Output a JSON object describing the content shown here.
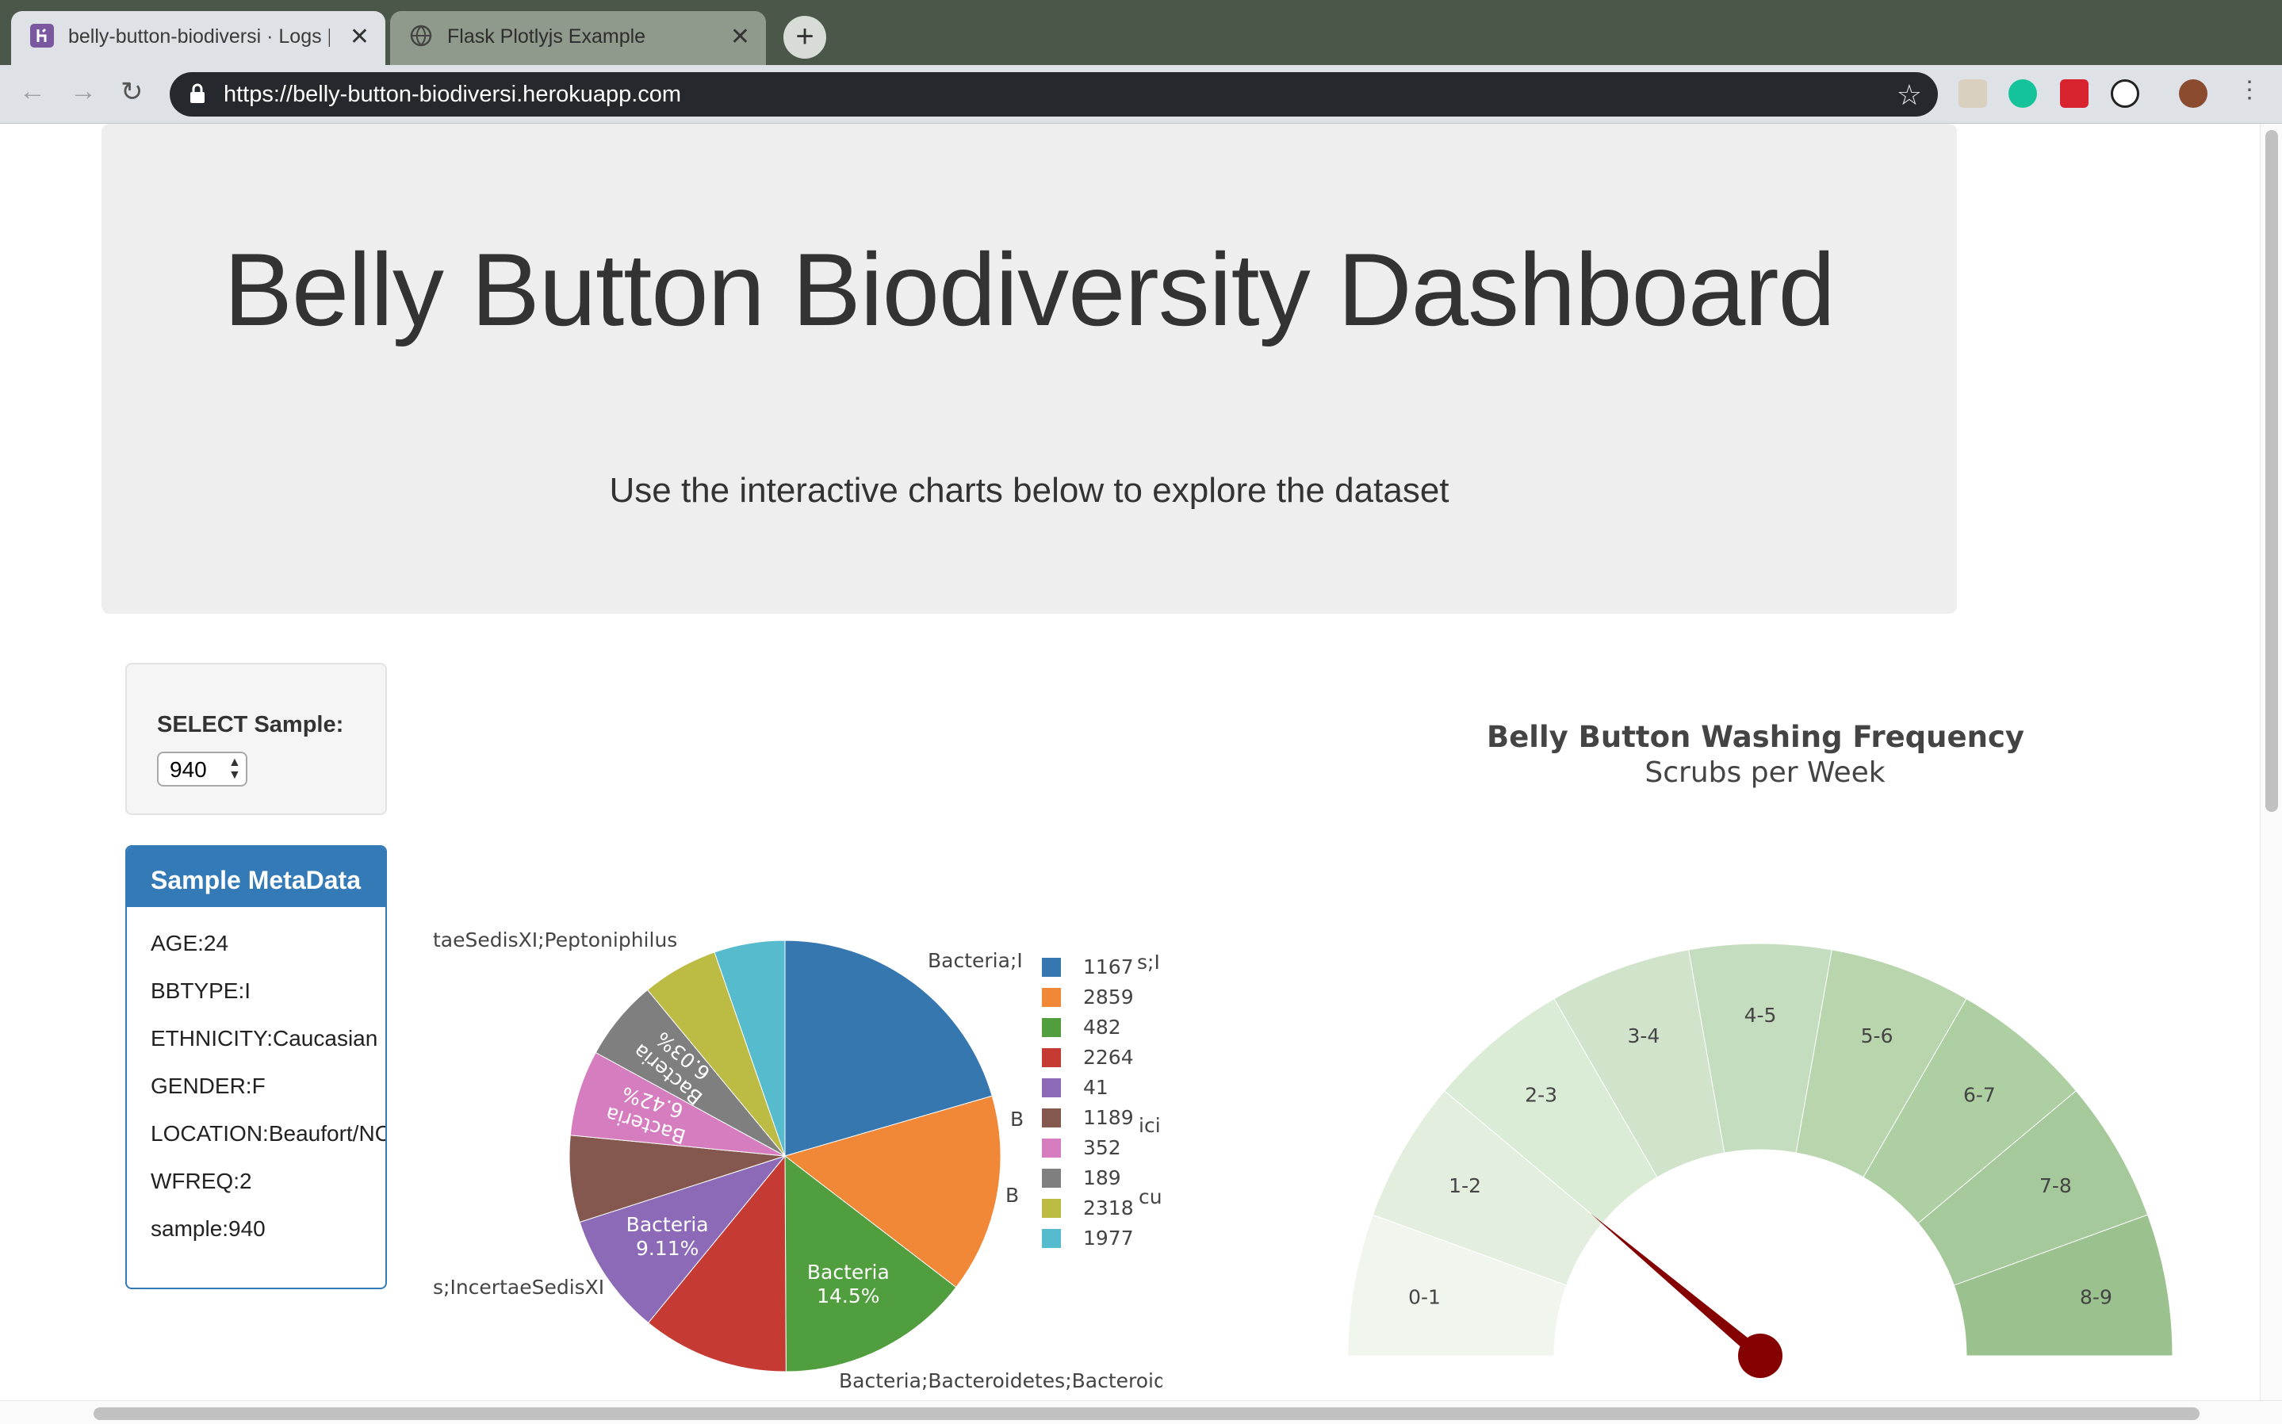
{
  "browser": {
    "tabs": [
      {
        "title": "belly-button-biodiversi · Logs | Heroku",
        "active": true
      },
      {
        "title": "Flask Plotlyjs Example",
        "active": false
      }
    ],
    "url": "https://belly-button-biodiversi.herokuapp.com"
  },
  "header": {
    "title": "Belly Button Biodiversity Dashboard",
    "subtitle": "Use the interactive charts below to explore the dataset"
  },
  "selector": {
    "label": "SELECT Sample:",
    "value": "940"
  },
  "metadata": {
    "heading": "Sample MetaData",
    "rows": [
      "AGE:24",
      "BBTYPE:I",
      "ETHNICITY:Caucasian",
      "GENDER:F",
      "LOCATION:Beaufort/NC",
      "WFREQ:2",
      "sample:940"
    ]
  },
  "chart_data": [
    {
      "type": "pie",
      "legend_placement": "right",
      "legend": [
        "1167",
        "2859",
        "482",
        "2264",
        "41",
        "1189",
        "352",
        "189",
        "2318",
        "1977"
      ],
      "values_percent": [
        20.5,
        14.9,
        14.5,
        11.0,
        9.11,
        6.5,
        6.42,
        6.03,
        5.7,
        5.3
      ],
      "colors": [
        "#3677af",
        "#f08837",
        "#519e3e",
        "#c53a32",
        "#8d6ab8",
        "#84584e",
        "#d57dbe",
        "#7f7f7f",
        "#bcbc45",
        "#56bbcc"
      ],
      "inside_labels": [
        {
          "index": 2,
          "text": "Bacteria",
          "pct": "14.5%"
        },
        {
          "index": 4,
          "text": "Bacteria",
          "pct": "9.11%"
        },
        {
          "index": 6,
          "text": "Bacteria",
          "pct": "6.42%"
        },
        {
          "index": 7,
          "text": "Bacteria",
          "pct": "6.03%"
        }
      ],
      "outside_labels": [
        "taeSedisXI;Peptoniphilus",
        "Bacteria;I",
        "B",
        "B",
        "s;IncertaeSedisXI",
        "Bacteria;Bacteroidetes;Bacteroidi",
        "s;I",
        "ici",
        "cu"
      ]
    },
    {
      "type": "gauge",
      "title": "Belly Button Washing Frequency",
      "subtitle": "Scrubs per Week",
      "segments": [
        "0-1",
        "1-2",
        "2-3",
        "3-4",
        "4-5",
        "5-6",
        "6-7",
        "7-8",
        "8-9"
      ],
      "segment_colors": [
        "#f0f5ee",
        "#e4eedf",
        "#daecd5",
        "#d1e4cb",
        "#c5ddbf",
        "#b8d5ae",
        "#adcfa2",
        "#a5c99a",
        "#9bc18f"
      ],
      "value": 2,
      "range": [
        0,
        9
      ],
      "needle_color": "#850000"
    }
  ]
}
